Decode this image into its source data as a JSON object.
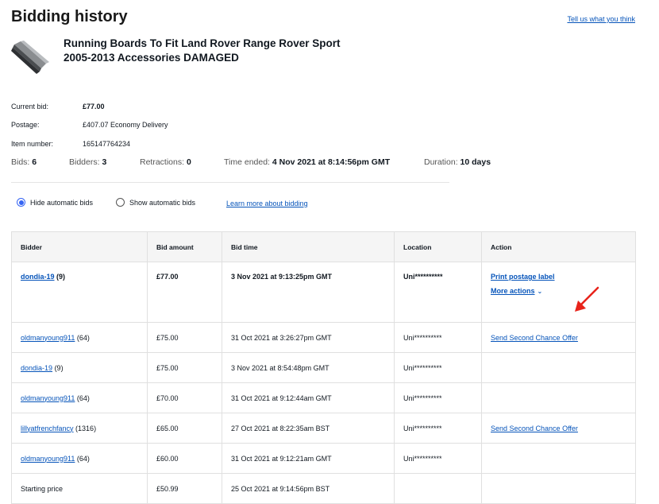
{
  "page": {
    "title": "Bidding history",
    "feedback_link": "Tell us what you think"
  },
  "item": {
    "title": "Running Boards To Fit Land Rover Range Rover Sport 2005-2013 Accessories DAMAGED"
  },
  "details": {
    "current_bid_label": "Current bid:",
    "current_bid_value": "£77.00",
    "postage_label": "Postage:",
    "postage_value": "£407.07 Economy Delivery",
    "item_number_label": "Item number:",
    "item_number_value": "165147764234"
  },
  "stats": {
    "bids_label": "Bids:",
    "bids_value": "6",
    "bidders_label": "Bidders:",
    "bidders_value": "3",
    "retractions_label": "Retractions:",
    "retractions_value": "0",
    "time_ended_label": "Time ended:",
    "time_ended_value": "4 Nov 2021 at 8:14:56pm GMT",
    "duration_label": "Duration:",
    "duration_value": "10 days"
  },
  "filters": {
    "hide_label": "Hide automatic bids",
    "show_label": "Show automatic bids",
    "selected": "hide",
    "learn_more": "Learn more about bidding"
  },
  "table": {
    "headers": [
      "Bidder",
      "Bid amount",
      "Bid time",
      "Location",
      "Action"
    ],
    "rows": [
      {
        "bidder": "dondia-19",
        "score": "(9)",
        "amount": "£77.00",
        "time": "3 Nov 2021 at 9:13:25pm GMT",
        "location": "Uni**********",
        "action": "Print postage label",
        "more": "More actions"
      },
      {
        "bidder": "oldmanyoung911",
        "score": "(64)",
        "amount": "£75.00",
        "time": "31 Oct 2021 at 3:26:27pm GMT",
        "location": "Uni**********",
        "action": "Send Second Chance Offer"
      },
      {
        "bidder": "dondia-19",
        "score": "(9)",
        "amount": "£75.00",
        "time": "3 Nov 2021 at 8:54:48pm GMT",
        "location": "Uni**********",
        "action": ""
      },
      {
        "bidder": "oldmanyoung911",
        "score": "(64)",
        "amount": "£70.00",
        "time": "31 Oct 2021 at 9:12:44am GMT",
        "location": "Uni**********",
        "action": ""
      },
      {
        "bidder": "lillyatfrenchfancy",
        "score": "(1316)",
        "amount": "£65.00",
        "time": "27 Oct 2021 at 8:22:35am BST",
        "location": "Uni**********",
        "action": "Send Second Chance Offer"
      },
      {
        "bidder": "oldmanyoung911",
        "score": "(64)",
        "amount": "£60.00",
        "time": "31 Oct 2021 at 9:12:21am GMT",
        "location": "Uni**********",
        "action": ""
      },
      {
        "label": "Starting price",
        "amount": "£50.99",
        "time": "25 Oct 2021 at 9:14:56pm BST",
        "location": "",
        "action": ""
      }
    ]
  },
  "colors": {
    "link": "#0654ba",
    "radio_accent": "#3665f3",
    "annotation_arrow": "#e8231b"
  }
}
